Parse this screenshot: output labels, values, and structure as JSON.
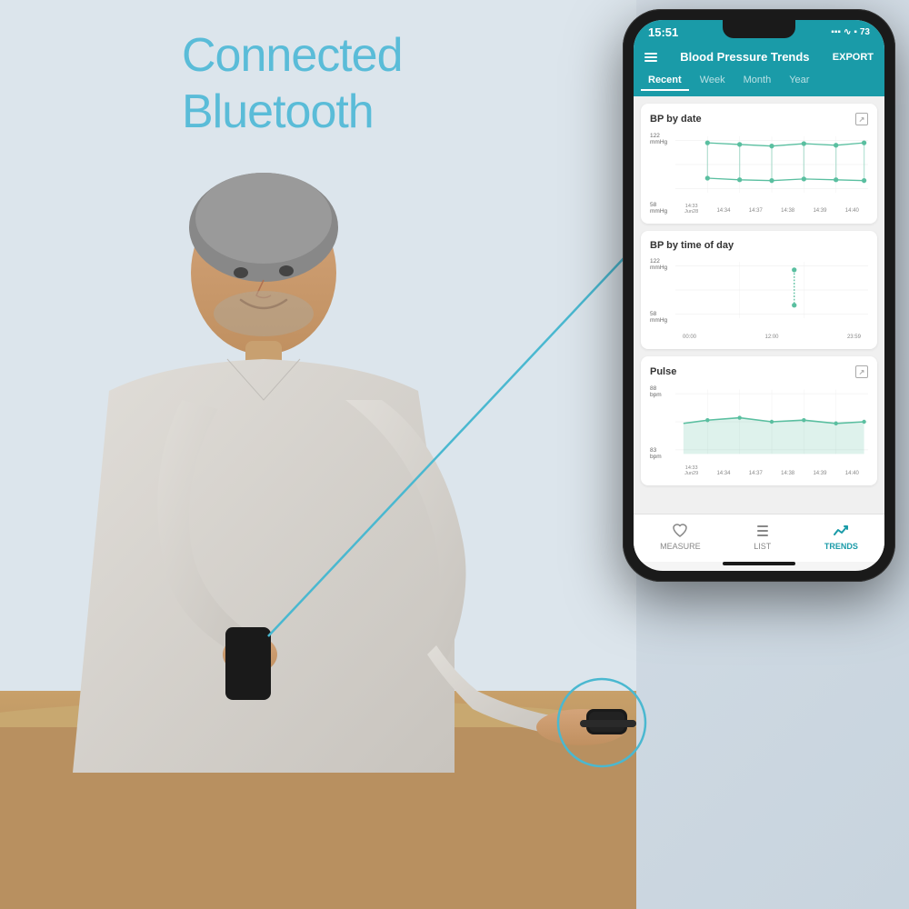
{
  "scene": {
    "hero_text_line1": "Connected",
    "hero_text_line2": "Bluetooth",
    "hero_text_color": "#5abcd8"
  },
  "phone": {
    "status_bar": {
      "time": "15:51",
      "battery": "73",
      "signal_bars": "|||"
    },
    "header": {
      "title": "Blood Pressure Trends",
      "export_label": "EXPORT",
      "menu_icon": "hamburger-icon"
    },
    "tabs": [
      {
        "label": "Recent",
        "active": true
      },
      {
        "label": "Week",
        "active": false
      },
      {
        "label": "Month",
        "active": false
      },
      {
        "label": "Year",
        "active": false
      }
    ],
    "charts": [
      {
        "title": "BP by date",
        "has_expand": true,
        "y_labels": [
          "122\nmmHg",
          "58\nmmHg"
        ],
        "x_labels": [
          "14:33\nJun28",
          "14:34",
          "14:37",
          "14:38",
          "14:39",
          "14:40"
        ],
        "type": "bp_date"
      },
      {
        "title": "BP by time of day",
        "has_expand": false,
        "y_labels": [
          "122\nmmHg",
          "58\nmmHg"
        ],
        "x_labels": [
          "00:00",
          "12:00",
          "23:59"
        ],
        "type": "bp_time"
      },
      {
        "title": "Pulse",
        "has_expand": true,
        "y_labels": [
          "88\nbpm",
          "83\nbpm"
        ],
        "x_labels": [
          "14:33\nJun29",
          "14:34",
          "14:37",
          "14:38",
          "14:39",
          "14:40"
        ],
        "type": "pulse"
      }
    ],
    "bottom_nav": [
      {
        "label": "MEASURE",
        "icon": "measure",
        "active": false
      },
      {
        "label": "LIST",
        "icon": "list",
        "active": false
      },
      {
        "label": "TRENDS",
        "icon": "trends",
        "active": true
      }
    ]
  }
}
